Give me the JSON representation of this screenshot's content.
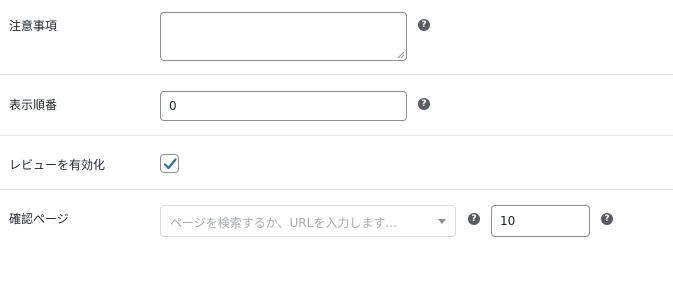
{
  "fields": {
    "notes": {
      "label": "注意事項",
      "value": ""
    },
    "display_order": {
      "label": "表示順番",
      "value": "0"
    },
    "enable_reviews": {
      "label": "レビューを有効化",
      "checked": true
    },
    "confirm_page": {
      "label": "確認ページ",
      "select_placeholder": "ページを検索するか、URLを入力します...",
      "number_value": "10"
    }
  },
  "help_icon_glyph": "?",
  "colors": {
    "checkmark": "#2271b1",
    "help_icon": "#595c60",
    "border": "#8c8f94"
  }
}
